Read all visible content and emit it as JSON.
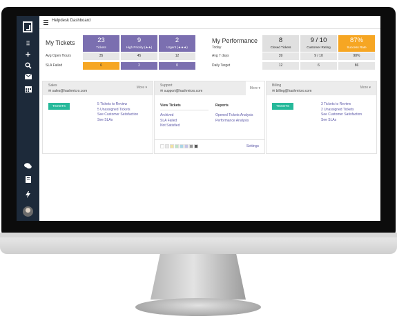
{
  "topbar": {
    "title": "Helpdesk Dashboard"
  },
  "sidebar": {
    "icons": [
      "grid-icon",
      "plus-icon",
      "search-icon",
      "envelope-icon",
      "calendar-icon",
      "chat-icon",
      "book-icon",
      "bolt-icon",
      "avatar"
    ]
  },
  "my_tickets": {
    "title": "My Tickets",
    "row_labels": [
      "Avg Open Hours",
      "SLA Failed"
    ],
    "cards": [
      {
        "value": "23",
        "label": "Tickets",
        "avg": "35",
        "sla": "6"
      },
      {
        "value": "9",
        "label": "High Priority (★★)",
        "avg": "45",
        "sla": "2"
      },
      {
        "value": "2",
        "label": "Urgent (★★★)",
        "avg": "12",
        "sla": "0"
      }
    ]
  },
  "my_performance": {
    "title": "My Performance",
    "subtitle": "Today",
    "row_labels": [
      "Avg 7 days",
      "Daily Target"
    ],
    "cards": [
      {
        "value": "8",
        "label": "Closed Tickets",
        "avg": "39",
        "target": "12"
      },
      {
        "value": "9 / 10",
        "label": "Customer Rating",
        "avg": "9 / 10",
        "target": "6"
      },
      {
        "value": "87%",
        "label": "Success Rate",
        "avg": "98%",
        "target": "86"
      }
    ]
  },
  "panels": {
    "sales": {
      "title": "Sales",
      "email": "sales@hashmicro.com",
      "more": "More ▾",
      "button": "TICKETS",
      "links": [
        "5 Tickets to Review",
        "5 Unassigned Tickets",
        "See Customer Satisfaction",
        "See SLAs"
      ]
    },
    "support": {
      "title": "Support",
      "email": "support@hashmicro.com",
      "more": "More ▾",
      "view_heading": "View Tickets",
      "view_links": [
        "Archived",
        "SLA Failed",
        "Not Satisfied"
      ],
      "reports_heading": "Reports",
      "report_links": [
        "Opened Tickets Analysis",
        "Performance Analysis"
      ],
      "settings": "Settings",
      "swatches": [
        "#ffffff",
        "#e9e9e9",
        "#f3e3a0",
        "#bfe3c8",
        "#a9d6e5",
        "#c4c4e6",
        "#9a9a9a",
        "#555555"
      ]
    },
    "billing": {
      "title": "Billing",
      "email": "billing@hashmicro.com",
      "more": "More ▾",
      "button": "TICKETS",
      "links": [
        "3 Tickets to Review",
        "2 Unassigned Tickets",
        "See Customer Satisfaction",
        "See SLAs"
      ]
    }
  },
  "colors": {
    "purple": "#7b6fb0",
    "orange": "#f6a623",
    "teal": "#26b99a",
    "sidebar": "#1d2a3a"
  }
}
